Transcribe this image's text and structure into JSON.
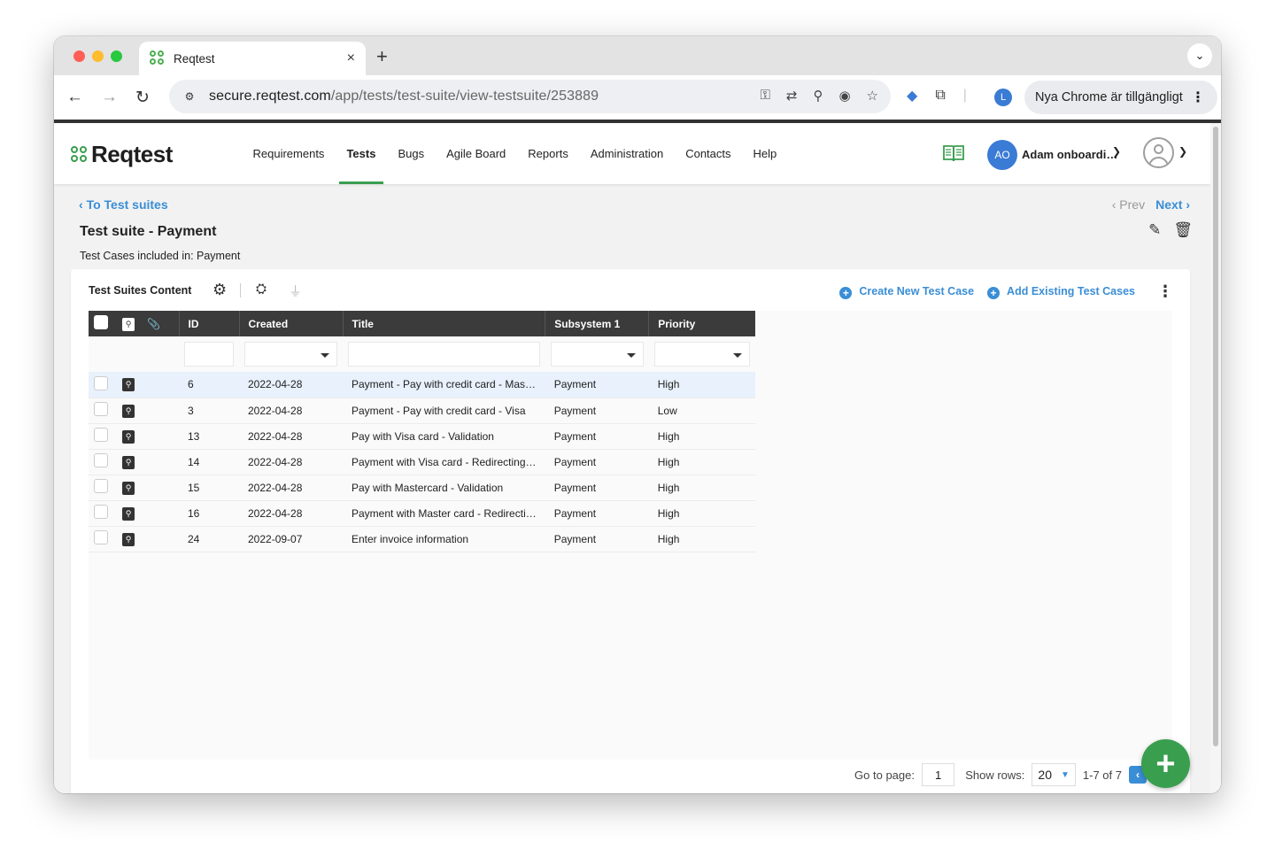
{
  "browser": {
    "tab_title": "Reqtest",
    "tab_close": "×",
    "new_tab": "+",
    "url_host": "secure.reqtest.com",
    "url_path": "/app/tests/test-suite/view-testsuite/253889",
    "profile_initial": "L",
    "update_label": "Nya Chrome är tillgängligt",
    "icons": [
      "password-key-icon",
      "translate-icon",
      "zoom-icon",
      "eye-off-icon",
      "star-icon",
      "extension-tag-icon",
      "puzzle-icon"
    ]
  },
  "app": {
    "logo": "Reqtest",
    "nav": [
      "Requirements",
      "Tests",
      "Bugs",
      "Agile Board",
      "Reports",
      "Administration",
      "Contacts",
      "Help"
    ],
    "active_nav": "Tests",
    "user_initials": "AO",
    "user_name": "Adam onboardi…",
    "accent": "#3a9e4f",
    "link_color": "#3a8ed6"
  },
  "page": {
    "back_link": "To Test suites",
    "prev": "Prev",
    "next": "Next",
    "title": "Test suite - Payment",
    "subtitle": "Test Cases included in: Payment"
  },
  "panel": {
    "title": "Test Suites Content",
    "create_label": "Create New Test Case",
    "add_label": "Add Existing Test Cases"
  },
  "table": {
    "columns": [
      "ID",
      "Created",
      "Title",
      "Subsystem 1",
      "Priority"
    ],
    "rows": [
      {
        "id": "6",
        "created": "2022-04-28",
        "title": "Payment - Pay with credit card - Mas…",
        "subsystem": "Payment",
        "priority": "High"
      },
      {
        "id": "3",
        "created": "2022-04-28",
        "title": "Payment - Pay with credit card - Visa",
        "subsystem": "Payment",
        "priority": "Low"
      },
      {
        "id": "13",
        "created": "2022-04-28",
        "title": "Pay with Visa card - Validation",
        "subsystem": "Payment",
        "priority": "High"
      },
      {
        "id": "14",
        "created": "2022-04-28",
        "title": "Payment with Visa card - Redirecting…",
        "subsystem": "Payment",
        "priority": "High"
      },
      {
        "id": "15",
        "created": "2022-04-28",
        "title": "Pay with Mastercard - Validation",
        "subsystem": "Payment",
        "priority": "High"
      },
      {
        "id": "16",
        "created": "2022-04-28",
        "title": "Payment with Master card - Redirecti…",
        "subsystem": "Payment",
        "priority": "High"
      },
      {
        "id": "24",
        "created": "2022-09-07",
        "title": "Enter invoice information",
        "subsystem": "Payment",
        "priority": "High"
      }
    ]
  },
  "pager": {
    "goto_label": "Go to page:",
    "goto_value": "1",
    "rows_label": "Show rows:",
    "rows_value": "20",
    "range": "1-7 of 7"
  },
  "fab_label": "+"
}
